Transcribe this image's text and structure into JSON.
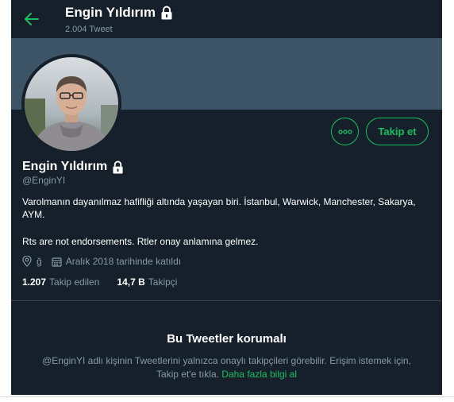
{
  "header": {
    "back_icon": "arrow-left-icon",
    "name": "Engin Yıldırım",
    "tweet_count": "2.004 Tweet",
    "lock_icon": "lock-icon"
  },
  "profile": {
    "avatar_icon": "avatar",
    "more_label": "more-options-icon",
    "follow_label": "Takip et",
    "name": "Engin Yıldırım",
    "handle": "@EnginYI",
    "bio_line1": "Varolmanın dayanılmaz hafifliği altında yaşayan biri. İstanbul, Warwick, Manchester, Sakarya, AYM.",
    "bio_line2": "Rts are not endorsements. Rtler onay anlamına gelmez.",
    "location": "ğ",
    "joined": "Aralık 2018 tarihinde katıldı",
    "following_count": "1.207",
    "following_label": "Takip edilen",
    "followers_count": "14,7 B",
    "followers_label": "Takipçi"
  },
  "protected": {
    "title": "Bu Tweetler korumalı",
    "text": "@EnginYI adlı kişinin Tweetlerini yalnızca onaylı takipçileri görebilir. Erişim istemek için, Takip et'e tıkla.",
    "link": "Daha fazla bilgi al"
  },
  "colors": {
    "background": "#15202b",
    "banner": "#3d5466",
    "accent": "#17bf63",
    "secondary_text": "#8899a6",
    "divider": "#38444d"
  }
}
